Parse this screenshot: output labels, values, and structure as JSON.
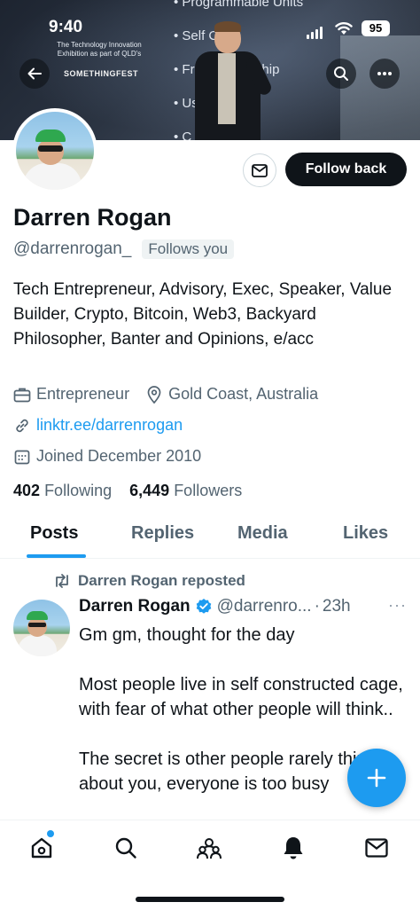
{
  "status_bar": {
    "time": "9:40",
    "battery": "95"
  },
  "banner": {
    "event_text": "The Technology Innovation Exhibition as part of QLD's",
    "event_logo": "SOMETHINGFEST",
    "bullets": [
      "Programmable Units",
      "Self Cus",
      "Fract   Ownership",
      "Us",
      "C"
    ]
  },
  "profile": {
    "name": "Darren Rogan",
    "handle": "@darrenrogan_",
    "follows_you": "Follows you",
    "follow_back_label": "Follow back",
    "bio": "Tech Entrepreneur, Advisory, Exec, Speaker, Value Builder, Crypto, Bitcoin, Web3, Backyard Philosopher, Banter and Opinions, e/acc",
    "occupation": "Entrepreneur",
    "location": "Gold Coast, Australia",
    "link": "linktr.ee/darrenrogan",
    "joined": "Joined December 2010",
    "following_count": "402",
    "following_label": "Following",
    "followers_count": "6,449",
    "followers_label": "Followers"
  },
  "tabs": [
    "Posts",
    "Replies",
    "Media",
    "Likes"
  ],
  "active_tab": "Posts",
  "post": {
    "repost_label": "Darren Rogan reposted",
    "author_name": "Darren Rogan",
    "author_handle": "@darrenro...",
    "separator": "·",
    "time": "23h",
    "more": "···",
    "text": "Gm gm, thought for the day\n\nMost people live in self constructed cage, with fear of what other people will think..\n\nThe secret is other people rarely think about you, everyone is too busy"
  },
  "colors": {
    "accent": "#1d9bf0",
    "text": "#0f1419",
    "secondary": "#536471"
  },
  "icons": {
    "back": "arrow-left-icon",
    "search": "search-icon",
    "more": "more-icon",
    "message": "envelope-icon",
    "occupation": "briefcase-icon",
    "location": "map-pin-icon",
    "link": "link-icon",
    "joined": "calendar-icon",
    "repost": "repost-icon",
    "verified": "verified-badge-icon",
    "compose": "plus-icon",
    "nav": [
      "home-icon",
      "search-icon",
      "communities-icon",
      "notifications-icon",
      "messages-icon"
    ]
  }
}
